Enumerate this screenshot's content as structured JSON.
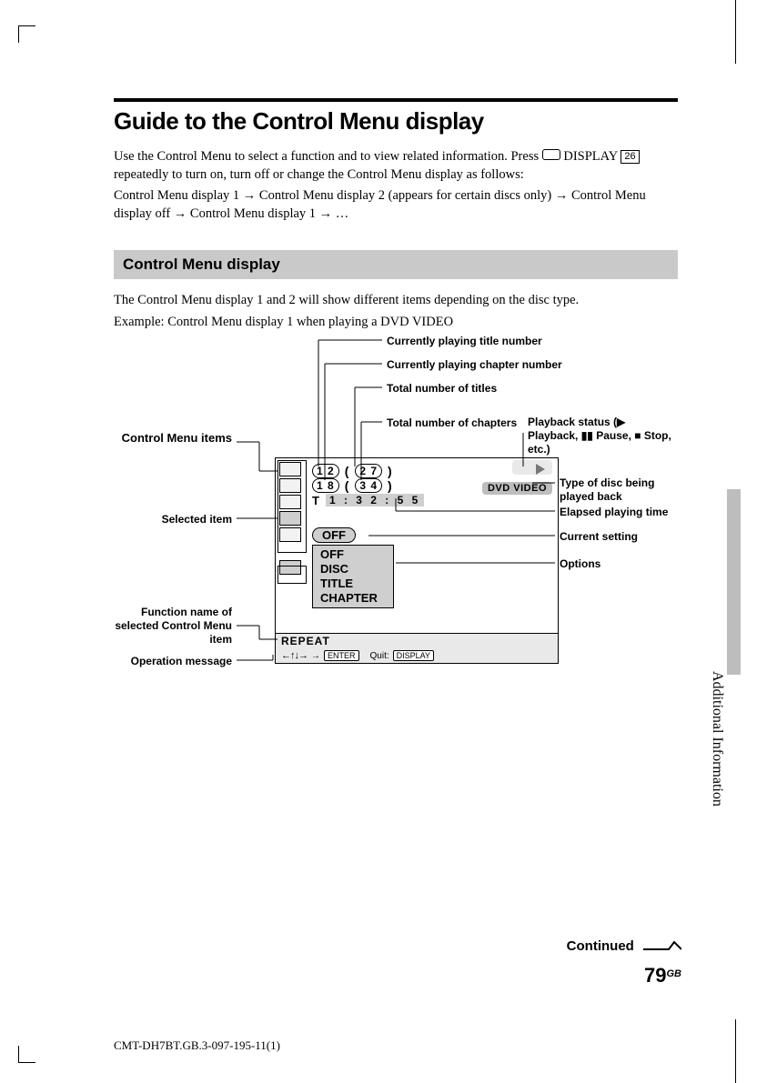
{
  "page": {
    "title": "Guide to the Control Menu display",
    "intro1a": "Use the Control Menu to select a function and to view related information. Press",
    "intro1b": "DISPLAY",
    "intro_boxnum": "26",
    "intro1c": "repeatedly to turn on, turn off or change the Control Menu display as follows:",
    "intro2": "Control Menu display 1 → Control Menu display 2 (appears for certain discs only) → Control Menu display off → Control Menu display 1 → …",
    "section_bar": "Control Menu display",
    "section_p1": "The Control Menu display 1 and 2 will show different items depending on the disc type.",
    "section_p2": "Example: Control Menu display 1 when playing a DVD VIDEO",
    "continued": "Continued",
    "page_number": "79",
    "page_region": "GB",
    "doc_id": "CMT-DH7BT.GB.3-097-195-11(1)",
    "side_tab": "Additional Information"
  },
  "callouts": {
    "top1": "Currently playing title number",
    "top2": "Currently playing chapter number",
    "top3": "Total number of titles",
    "top4": "Total number of chapters",
    "right_play": "Playback status (▶ Playback, ▮▮ Pause, ■ Stop, etc.)",
    "right_type": "Type of disc being played back",
    "right_elapsed": "Elapsed playing time",
    "right_setting": "Current setting",
    "right_options": "Options",
    "left_items": "Control Menu items",
    "left_selected": "Selected item",
    "left_func": "Function name of selected Control Menu item",
    "left_op": "Operation message"
  },
  "osd": {
    "title_cur": "1 2",
    "title_tot": "2 7",
    "chap_cur": "1 8",
    "chap_tot": "3 4",
    "time_prefix": "T",
    "time": "1 : 3 2 : 5 5",
    "disc_badge": "DVD VIDEO",
    "off1": "OFF",
    "opt1": "OFF",
    "opt2": "DISC",
    "opt3": "TITLE",
    "opt4": "CHAPTER",
    "func_name": "REPEAT",
    "help_enter": "ENTER",
    "help_quit": "Quit:",
    "help_display": "DISPLAY"
  }
}
